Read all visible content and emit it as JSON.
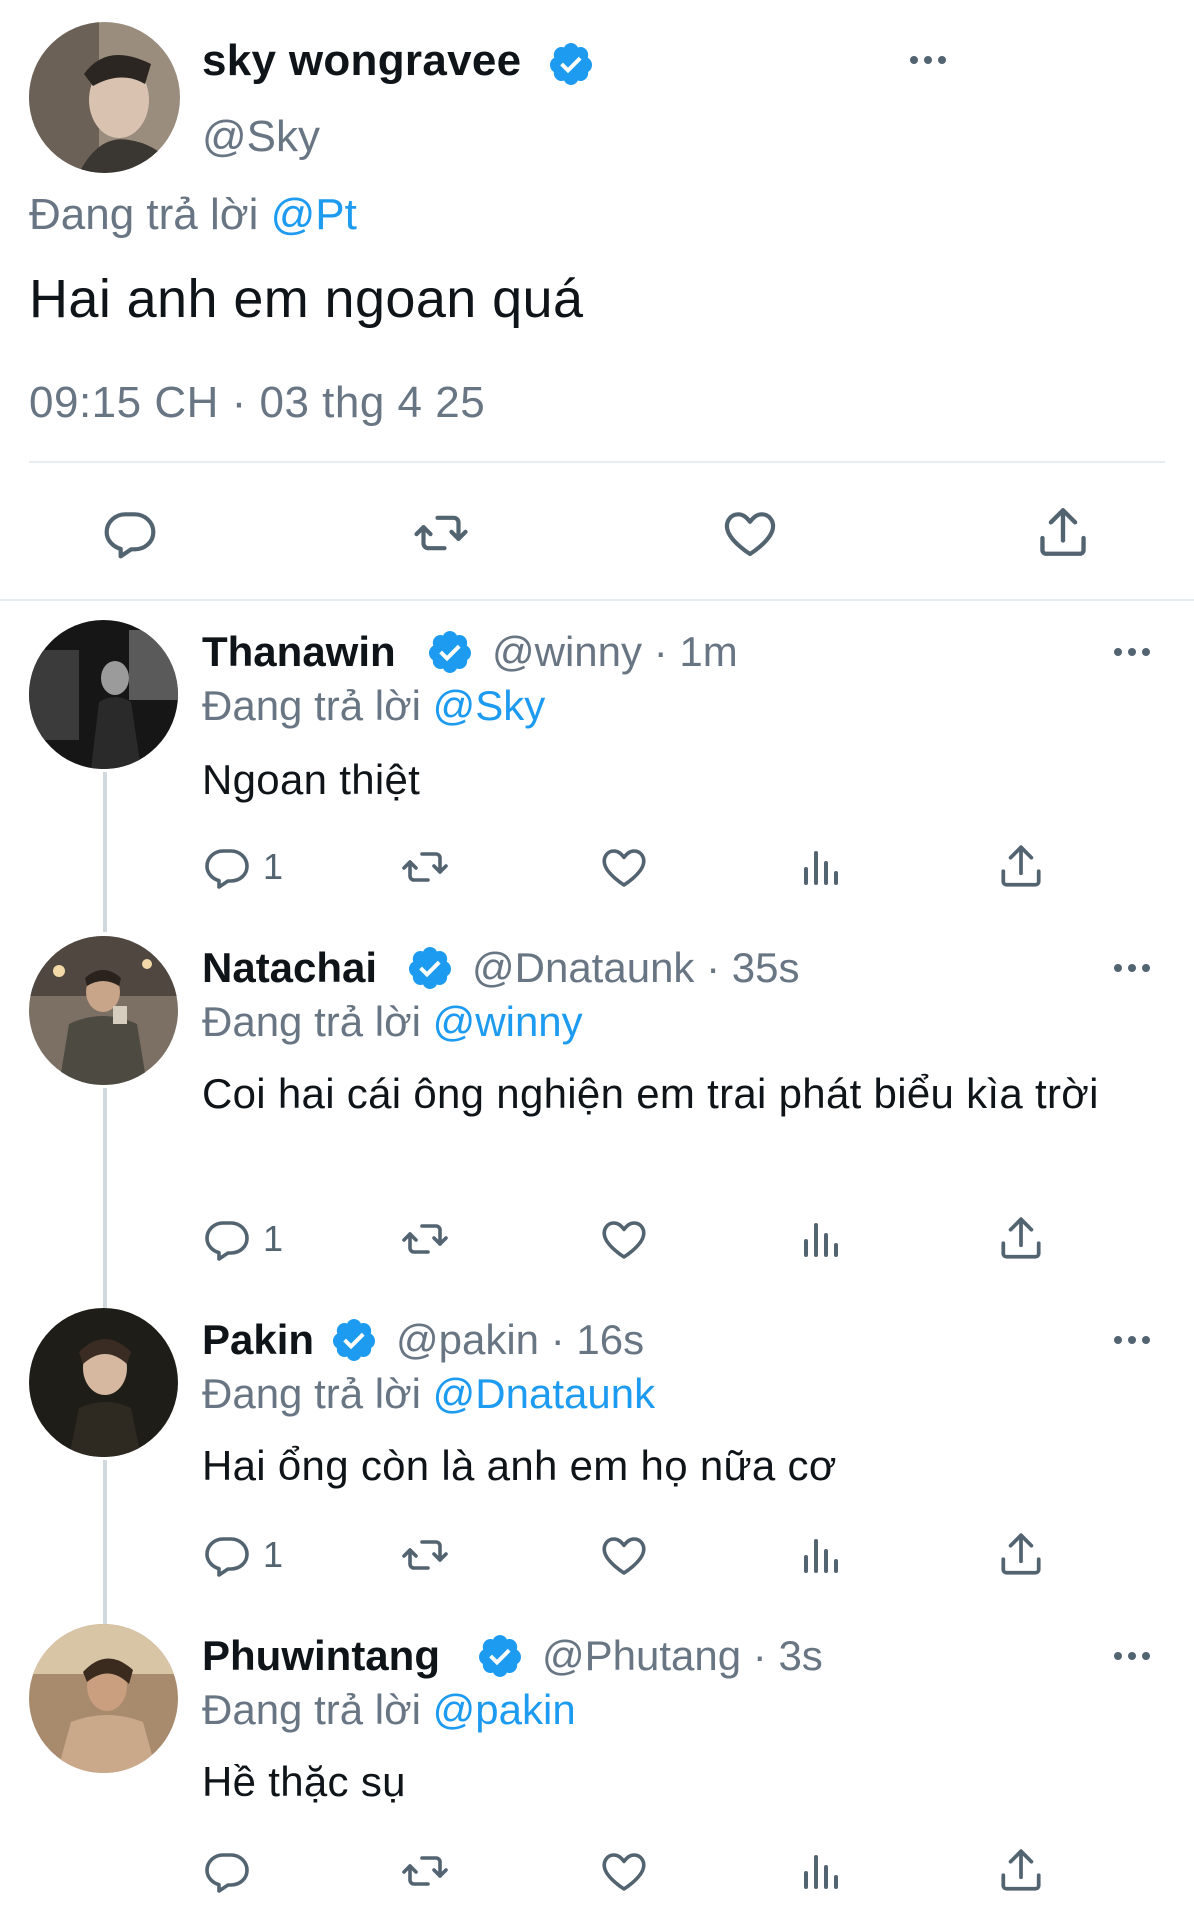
{
  "main_tweet": {
    "name": "sky wongravee",
    "handle": "@Sky",
    "reply_prefix": "Đang trả lời",
    "reply_to": "@Pt",
    "text": "Hai anh em ngoan quá",
    "timestamp": "09:15 CH · 03 thg 4 25",
    "actions": [
      "reply-icon",
      "retweet-icon",
      "like-icon",
      "share-icon"
    ]
  },
  "replies": [
    {
      "name": "Thanawin",
      "handle": "@winny",
      "time": "· 1m",
      "reply_prefix": "Đang trả lời",
      "reply_to": "@Sky",
      "text": "Ngoan thiệt",
      "reply_count": "1"
    },
    {
      "name": "Natachai",
      "handle": "@Dnataunk",
      "time": "· 35s",
      "reply_prefix": "Đang trả lời",
      "reply_to": "@winny",
      "text": "Coi hai cái ông nghiện em trai phát biểu kìa trời",
      "reply_count": "1"
    },
    {
      "name": "Pakin",
      "handle": "@pakin",
      "time": "· 16s",
      "reply_prefix": "Đang trả lời",
      "reply_to": "@Dnataunk",
      "text": "Hai ổng còn là anh em họ nữa cơ",
      "reply_count": "1"
    },
    {
      "name": "Phuwintang",
      "handle": "@Phutang",
      "time": "· 3s",
      "reply_prefix": "Đang trả lời",
      "reply_to": "@pakin",
      "text": "Hề thặc sụ",
      "reply_count": ""
    }
  ],
  "colors": {
    "accent": "#1d9bf0",
    "secondary_text": "#687684",
    "divider": "#e6ecf0",
    "icon": "#536471"
  }
}
